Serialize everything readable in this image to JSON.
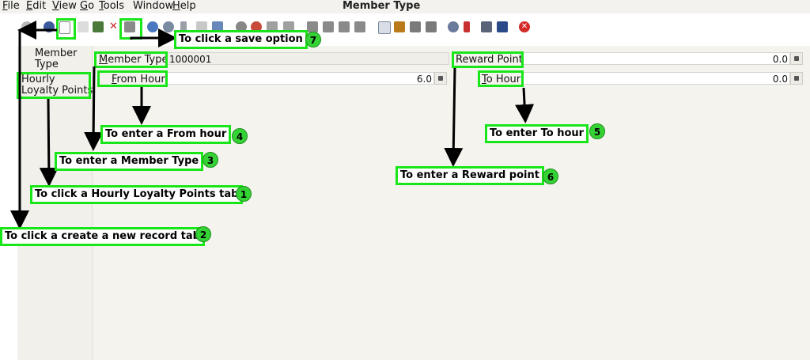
{
  "menu": {
    "items": [
      {
        "label": "File",
        "mnemonic": "F",
        "rest": "ile"
      },
      {
        "label": "Edit",
        "mnemonic": "E",
        "rest": "dit"
      },
      {
        "label": "View",
        "mnemonic": "V",
        "rest": "iew"
      },
      {
        "label": "Go",
        "mnemonic": "G",
        "rest": "o"
      },
      {
        "label": "Tools",
        "mnemonic": "T",
        "rest": "ools"
      },
      {
        "label": "Window",
        "mnemonic": "",
        "rest": "Window"
      },
      {
        "label": "Help",
        "mnemonic": "H",
        "rest": "elp"
      }
    ],
    "window_title": "Member Type"
  },
  "toolbar": {
    "icons": [
      "back-icon",
      "help-icon",
      "new-record-icon",
      "copy-record-icon",
      "archive-icon",
      "delete-icon",
      "save-icon",
      "refresh-icon",
      "find-icon",
      "attachment-icon",
      "multi-view-icon",
      "grid-icon",
      "history-icon",
      "home-icon",
      "previous-icon",
      "next-icon",
      "first-icon",
      "up-icon",
      "down-icon",
      "last-icon",
      "report-icon",
      "archived-docs-icon",
      "print-preview-icon",
      "print-icon",
      "zoom-across-icon",
      "workflow-icon",
      "request-icon",
      "product-info-icon",
      "close-window-icon"
    ]
  },
  "tabs": {
    "member_type_line1": "Member",
    "member_type_line2": "Type",
    "hourly_line1": "Hourly",
    "hourly_line2": "Loyalty Points"
  },
  "form": {
    "member_type_label": "Member Type",
    "member_type_mnemonic": "M",
    "member_type_value": "1000001",
    "reward_point_label": "Reward Point",
    "reward_point_value": "0.0",
    "from_hour_label": "From Hour",
    "from_hour_mnemonic": "F",
    "from_hour_value": "6.0",
    "to_hour_label": "To Hour",
    "to_hour_mnemonic": "T",
    "to_hour_value": "0.0"
  },
  "callouts": {
    "save": {
      "text": "To click a save option",
      "num": "7"
    },
    "from_hour": {
      "text": "To enter a From hour",
      "num": "4"
    },
    "to_hour": {
      "text": "To enter To hour",
      "num": "5"
    },
    "member_type": {
      "text": "To enter a Member Type",
      "num": "3"
    },
    "reward": {
      "text": "To enter a Reward point",
      "num": "6"
    },
    "hourly_tab": {
      "text": "To click a Hourly Loyalty Points tab",
      "num": "1"
    },
    "new_record": {
      "text": "To click a create a new record tab",
      "num": "2"
    }
  },
  "colors": {
    "annotation_green": "#19e619",
    "badge_green": "#35d235"
  }
}
